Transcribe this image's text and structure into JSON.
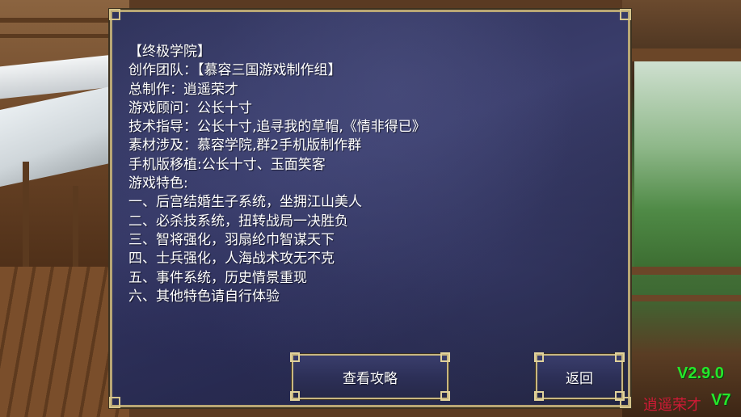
{
  "panel": {
    "lines": [
      "【终极学院】",
      "创作团队：【慕容三国游戏制作组】",
      "总制作：逍遥荣才",
      "游戏顾问：公长十寸",
      "技术指导：公长十寸,追寻我的草帽,《情非得已》",
      "素材涉及：慕容学院,群2手机版制作群",
      "手机版移植:公长十寸、玉面笑客",
      "游戏特色:",
      "一、后宫结婚生子系统，坐拥江山美人",
      "二、必杀技系统，扭转战局一决胜负",
      "三、智将强化，羽扇纶巾智谋天下",
      "四、士兵强化，人海战术攻无不克",
      "五、事件系统，历史情景重现",
      "六、其他特色请自行体验"
    ]
  },
  "buttons": {
    "guide_label": "查看攻略",
    "back_label": "返回"
  },
  "overlay": {
    "version": "V2.9.0",
    "author": "逍遥荣才",
    "v7": "V7"
  },
  "colors": {
    "panel_border": "#b9a774",
    "panel_bg": "#2c2f55",
    "version_green": "#25e62b",
    "author_red": "#e0193a"
  }
}
